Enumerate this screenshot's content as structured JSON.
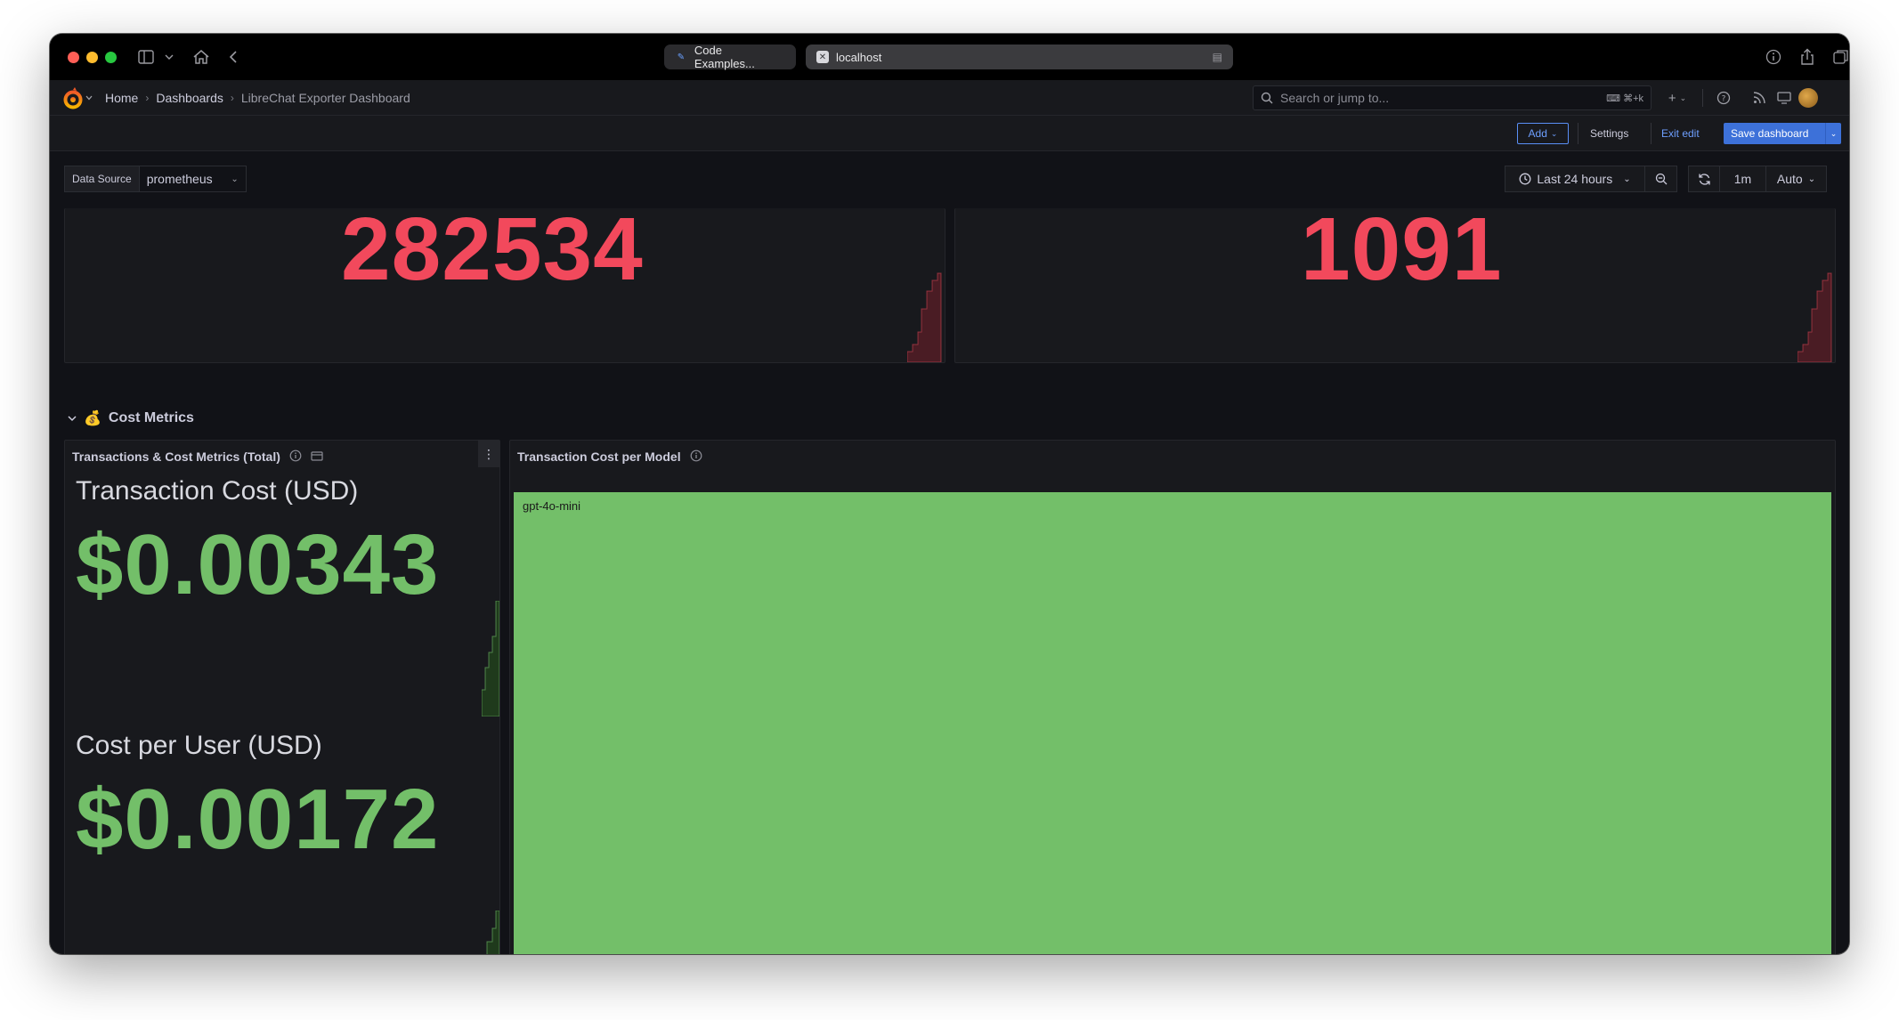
{
  "browser": {
    "tabs": [
      {
        "title": "Code Examples..."
      },
      {
        "title": "localhost"
      }
    ]
  },
  "nav": {
    "breadcrumbs": [
      "Home",
      "Dashboards",
      "LibreChat Exporter Dashboard"
    ],
    "search_placeholder": "Search or jump to...",
    "search_shortcut": "⌘+k"
  },
  "toolbar": {
    "add_label": "Add",
    "settings_label": "Settings",
    "exit_edit_label": "Exit edit",
    "save_label": "Save dashboard"
  },
  "variables": {
    "datasource_label": "Data Source",
    "datasource_value": "prometheus"
  },
  "time": {
    "range": "Last 24 hours",
    "refresh_interval": "1m",
    "auto": "Auto"
  },
  "top_stats": [
    {
      "value": "282534",
      "color": "#f2495c"
    },
    {
      "value": "1091",
      "color": "#f2495c"
    }
  ],
  "cost_row": {
    "title": "Cost Metrics",
    "emoji": "💰"
  },
  "cost_panel": {
    "title": "Transactions & Cost Metrics (Total)",
    "stats": [
      {
        "label": "Transaction Cost (USD)",
        "value": "$0.00343"
      },
      {
        "label": "Cost per User (USD)",
        "value": "$0.00172"
      }
    ],
    "value_color": "#73bf69"
  },
  "model_panel": {
    "title": "Transaction Cost per Model",
    "segments": [
      {
        "label": "gpt-4o-mini",
        "color": "#73bf69"
      }
    ]
  }
}
